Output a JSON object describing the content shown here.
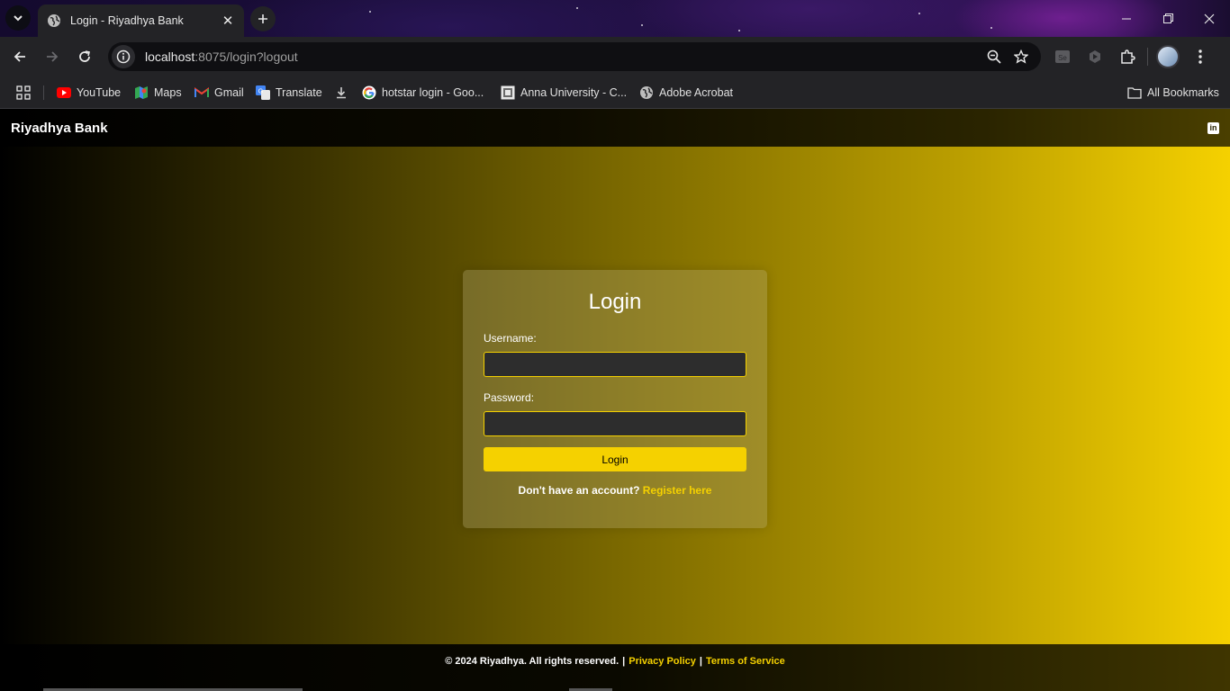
{
  "browser": {
    "tab": {
      "title": "Login - Riyadhya Bank"
    },
    "url": {
      "host": "localhost",
      "rest": ":8075/login?logout"
    },
    "bookmarks": [
      {
        "label": "YouTube",
        "icon": "youtube-icon"
      },
      {
        "label": "Maps",
        "icon": "maps-icon"
      },
      {
        "label": "Gmail",
        "icon": "gmail-icon"
      },
      {
        "label": "Translate",
        "icon": "translate-icon"
      },
      {
        "label": "",
        "icon": "download-icon"
      },
      {
        "label": "hotstar login - Goo...",
        "icon": "google-icon"
      },
      {
        "label": "Anna University - C...",
        "icon": "anna-university-icon"
      },
      {
        "label": "Adobe Acrobat",
        "icon": "globe-icon"
      }
    ],
    "all_bookmarks": "All Bookmarks"
  },
  "site": {
    "brand": "Riyadhya Bank",
    "login": {
      "title": "Login",
      "username_label": "Username:",
      "username_value": "",
      "password_label": "Password:",
      "password_value": "",
      "button": "Login",
      "register_prompt": "Don't have an account?",
      "register_link": "Register here"
    },
    "footer": {
      "copyright": "© 2024 Riyadhya. All rights reserved.",
      "sep": "|",
      "privacy": "Privacy Policy",
      "terms": "Terms of Service"
    }
  },
  "colors": {
    "accent": "#f5d100",
    "input_bg": "#2d2d2d"
  }
}
